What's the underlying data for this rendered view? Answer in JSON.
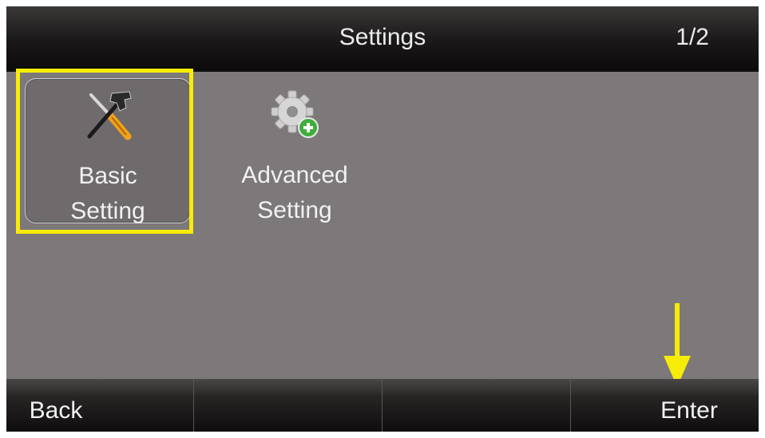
{
  "header": {
    "title": "Settings",
    "page_indicator": "1/2"
  },
  "items": [
    {
      "label_line1": "Basic",
      "label_line2": "Setting",
      "icon": "tools-icon",
      "selected": true
    },
    {
      "label_line1": "Advanced",
      "label_line2": "Setting",
      "icon": "gear-plus-icon",
      "selected": false
    }
  ],
  "softkeys": [
    "Back",
    "",
    "",
    "Enter"
  ],
  "colors": {
    "highlight": "#f6ec07",
    "annotation_arrow": "#f6ec07",
    "background": "#7d787a"
  }
}
